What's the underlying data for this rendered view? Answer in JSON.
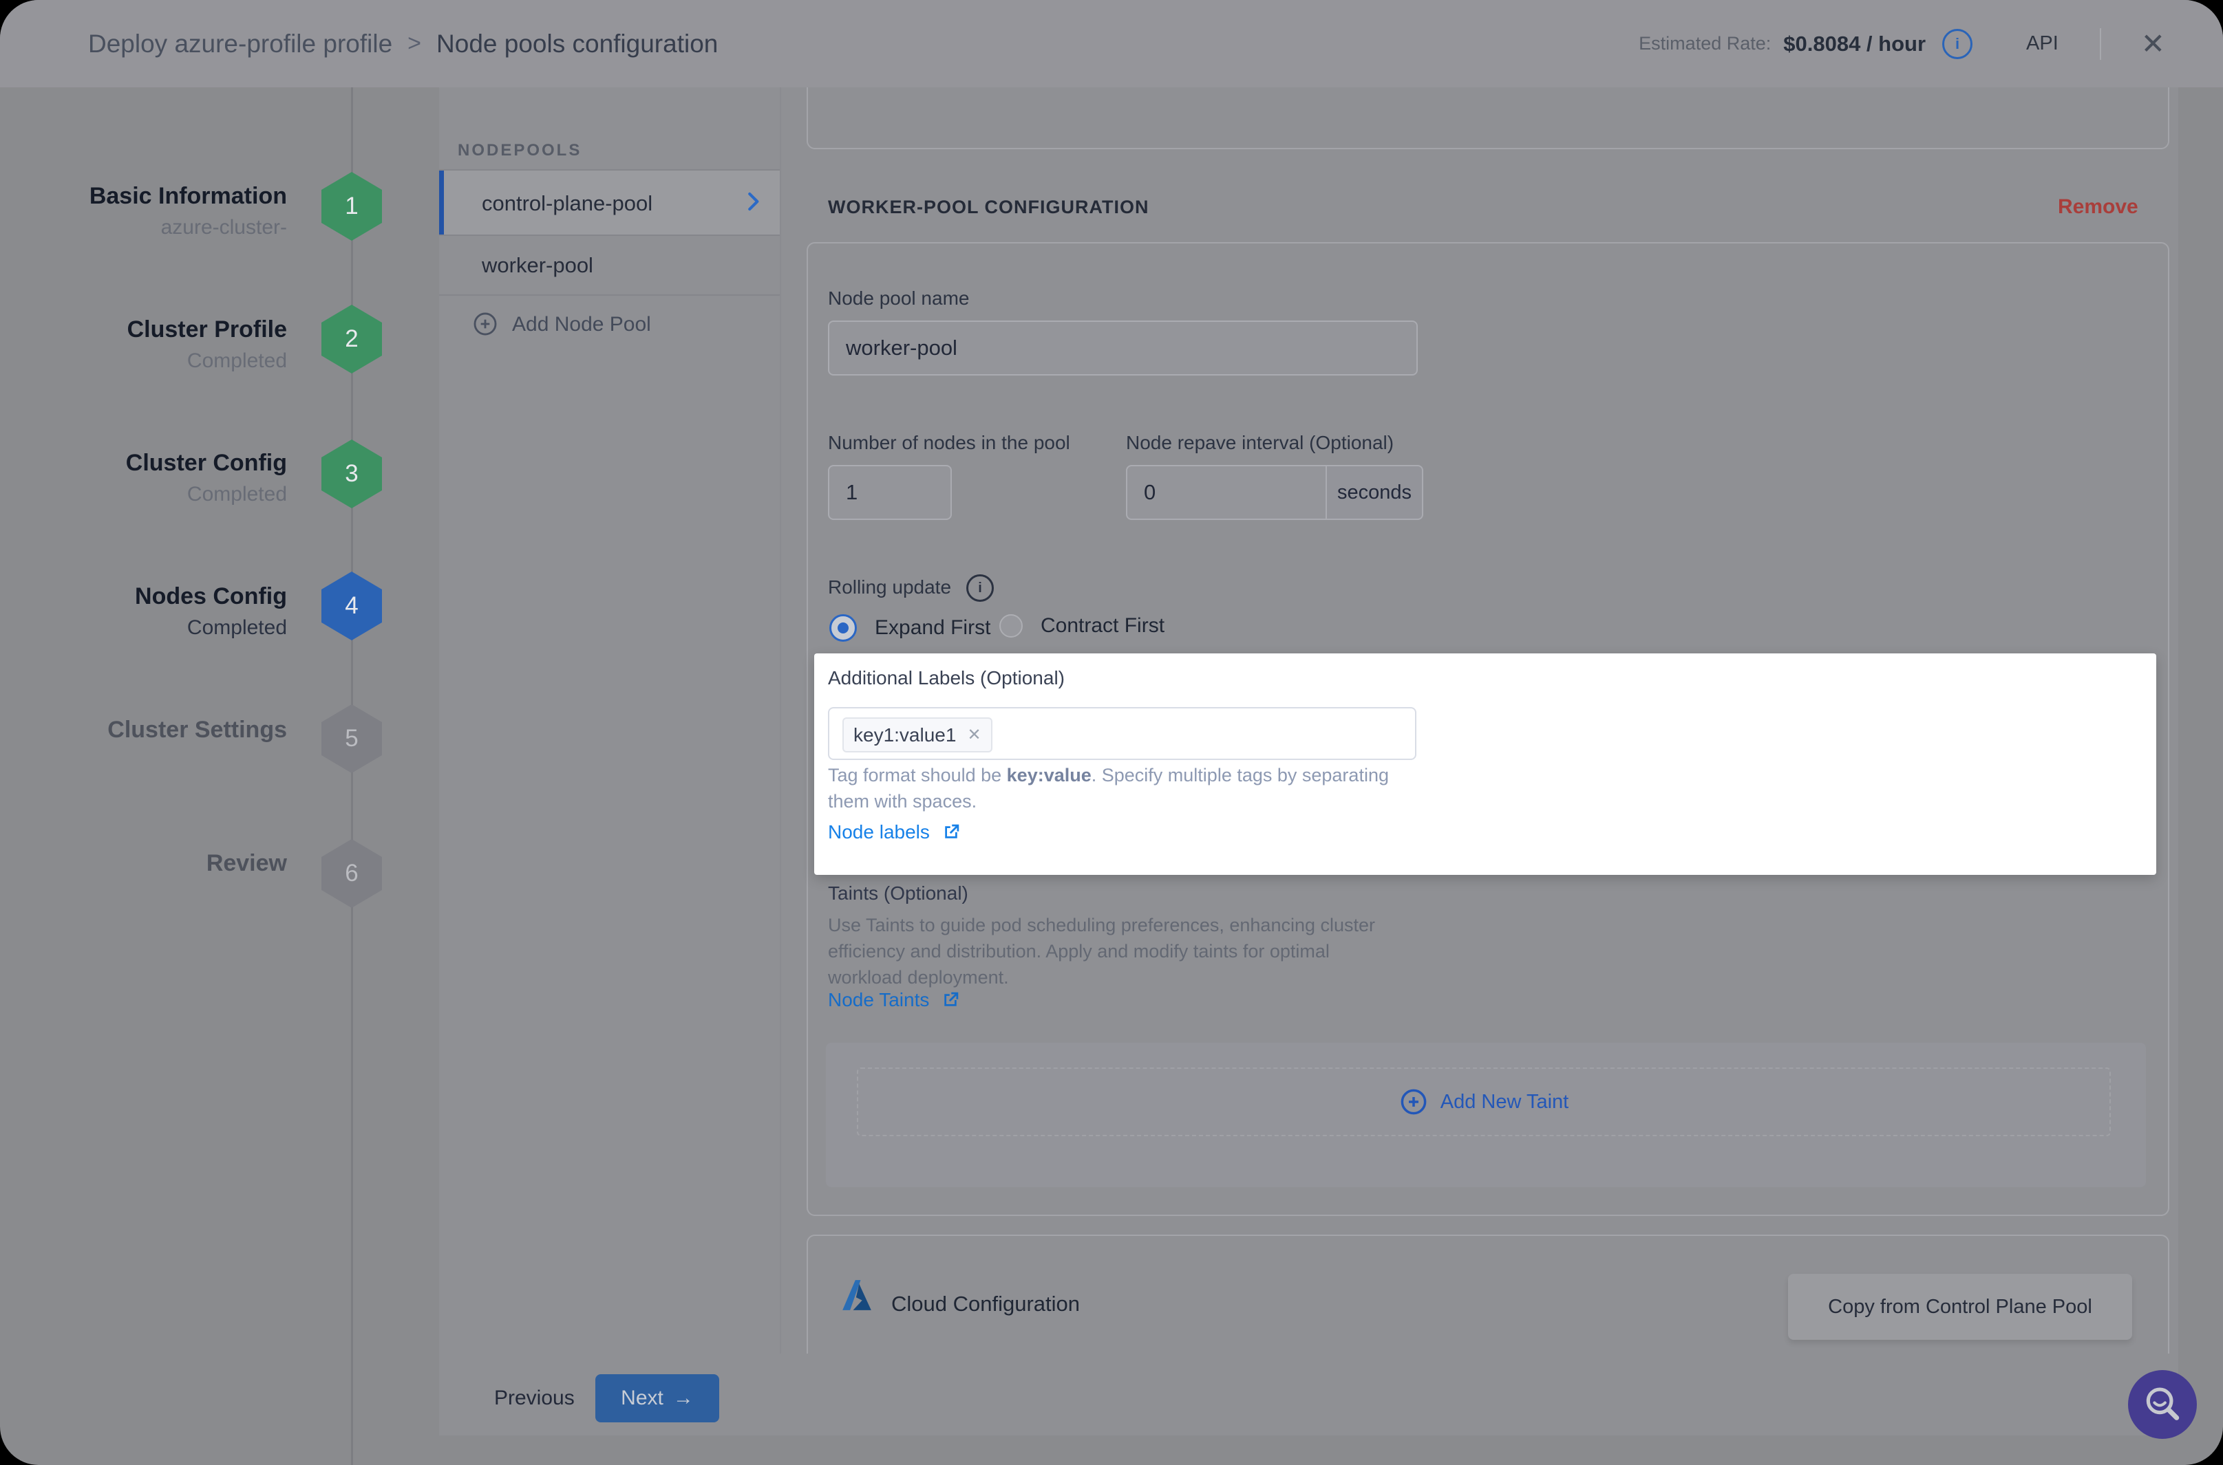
{
  "header": {
    "breadcrumb_1": "Deploy azure-profile profile",
    "separator": ">",
    "breadcrumb_2": "Node pools configuration",
    "estimated_rate_label": "Estimated Rate:",
    "estimated_rate_value": "$0.8084 / hour",
    "info_icon": "i",
    "api_label": "API",
    "close_icon": "✕"
  },
  "stepper": {
    "steps": [
      {
        "num": "1",
        "title": "Basic Information",
        "subtitle": "azure-cluster-",
        "state": "completed"
      },
      {
        "num": "2",
        "title": "Cluster Profile",
        "subtitle": "Completed",
        "state": "completed"
      },
      {
        "num": "3",
        "title": "Cluster Config",
        "subtitle": "Completed",
        "state": "completed"
      },
      {
        "num": "4",
        "title": "Nodes Config",
        "subtitle": "Completed",
        "state": "active"
      },
      {
        "num": "5",
        "title": "Cluster Settings",
        "subtitle": "",
        "state": "upcoming"
      },
      {
        "num": "6",
        "title": "Review",
        "subtitle": "",
        "state": "upcoming"
      }
    ]
  },
  "nodepools": {
    "panel_title": "NODEPOOLS",
    "items": [
      {
        "label": "control-plane-pool",
        "selected": true
      },
      {
        "label": "worker-pool",
        "selected": false
      }
    ],
    "add_label": "Add Node Pool"
  },
  "worker_config": {
    "section_title": "WORKER-POOL CONFIGURATION",
    "remove_label": "Remove",
    "name_label": "Node pool name",
    "name_value": "worker-pool",
    "count_label": "Number of nodes in the pool",
    "count_value": "1",
    "repave_label": "Node repave interval (Optional)",
    "repave_value": "0",
    "repave_unit": "seconds",
    "rolling_label": "Rolling update",
    "radio_expand": "Expand First",
    "radio_contract": "Contract First"
  },
  "labels_section": {
    "title": "Additional Labels (Optional)",
    "tag_value": "key1:value1",
    "tag_remove": "✕",
    "helper_pre": "Tag format should be ",
    "helper_bold": "key:value",
    "helper_post": ". Specify multiple tags by separating",
    "helper_line2": "them with spaces.",
    "link_label": "Node labels"
  },
  "taints": {
    "title": "Taints (Optional)",
    "desc_line1": "Use Taints to guide pod scheduling preferences, enhancing cluster",
    "desc_line2": "efficiency and distribution. Apply and modify taints for optimal",
    "desc_line3": "workload deployment.",
    "link_label": "Node Taints",
    "add_button": "Add New Taint"
  },
  "cloud": {
    "title": "Cloud Configuration",
    "copy_button": "Copy from Control Plane Pool"
  },
  "footer": {
    "previous": "Previous",
    "next": "Next",
    "next_arrow": "→"
  },
  "colors": {
    "step_completed_green": "#3d9162",
    "step_active_blue": "#2b63b4",
    "step_upcoming_gray": "#7e7f85",
    "accent_blue": "#2a66c4",
    "link_blue": "#1781e8",
    "remove_red": "#a93e3b",
    "next_button_blue": "#2e5f9e",
    "fab_purple": "#453c90",
    "spotlight_bg": "#ffffff"
  }
}
